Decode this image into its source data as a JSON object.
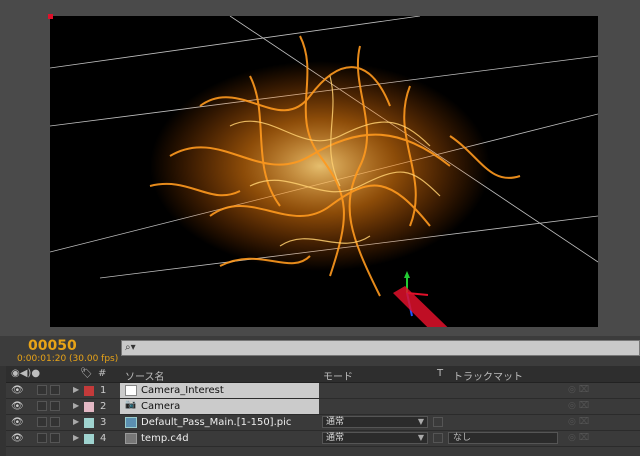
{
  "time": {
    "frame": "00050",
    "timecode": "0:00:01:20 (30.00 fps)"
  },
  "search": {
    "icon": "search-icon",
    "placeholder": ""
  },
  "columns": {
    "number": "#",
    "source_name": "ソース名",
    "mode": "モード",
    "t": "T",
    "track_matte": "トラックマット"
  },
  "layers": [
    {
      "num": "1",
      "name": "Camera_Interest",
      "label_color": "#c43a3a",
      "thumb": "null-icon",
      "mode": "",
      "track_matte": ""
    },
    {
      "num": "2",
      "name": "Camera",
      "label_color": "#e3b8c4",
      "thumb": "camera-icon",
      "mode": "",
      "track_matte": ""
    },
    {
      "num": "3",
      "name": "Default_Pass_Main.[1-150].pic",
      "label_color": "#9fd3cf",
      "thumb": "footage-icon",
      "mode": "通常",
      "track_matte": ""
    },
    {
      "num": "4",
      "name": "temp.c4d",
      "label_color": "#9fd3cf",
      "thumb": "c4d-icon",
      "mode": "通常",
      "track_matte": "なし"
    }
  ],
  "colors": {
    "accent_time": "#e8a317",
    "fire": "#ff9a1f",
    "annotation_arrow": "#e0102a"
  }
}
